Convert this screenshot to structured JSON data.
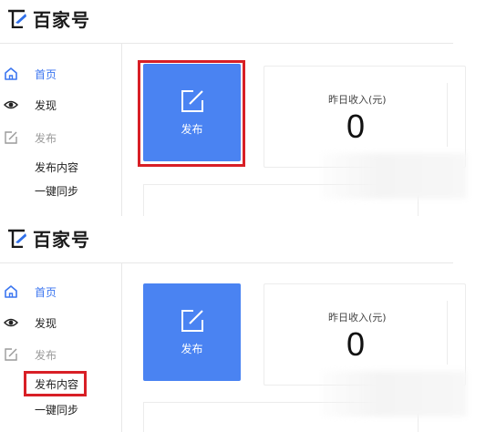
{
  "brand": {
    "name": "百家号"
  },
  "colors": {
    "accent": "#4a83f2",
    "highlight": "#d81f26",
    "nav_active": "#3c76f0"
  },
  "panels": [
    {
      "sidebar": {
        "home": {
          "label": "首页",
          "icon": "home-icon"
        },
        "discover": {
          "label": "发现",
          "icon": "eye-icon"
        },
        "publish": {
          "label": "发布",
          "icon": "edit-icon"
        },
        "publish_content": {
          "label": "发布内容"
        },
        "one_click_sync": {
          "label": "一键同步"
        }
      },
      "publish_card": {
        "label": "发布",
        "icon": "edit-icon",
        "highlighted": true
      },
      "income_card": {
        "label": "昨日收入(元)",
        "value": "0"
      }
    },
    {
      "sidebar": {
        "home": {
          "label": "首页",
          "icon": "home-icon"
        },
        "discover": {
          "label": "发现",
          "icon": "eye-icon"
        },
        "publish": {
          "label": "发布",
          "icon": "edit-icon"
        },
        "publish_content": {
          "label": "发布内容",
          "highlighted": true
        },
        "one_click_sync": {
          "label": "一键同步"
        }
      },
      "publish_card": {
        "label": "发布",
        "icon": "edit-icon"
      },
      "income_card": {
        "label": "昨日收入(元)",
        "value": "0"
      }
    }
  ]
}
